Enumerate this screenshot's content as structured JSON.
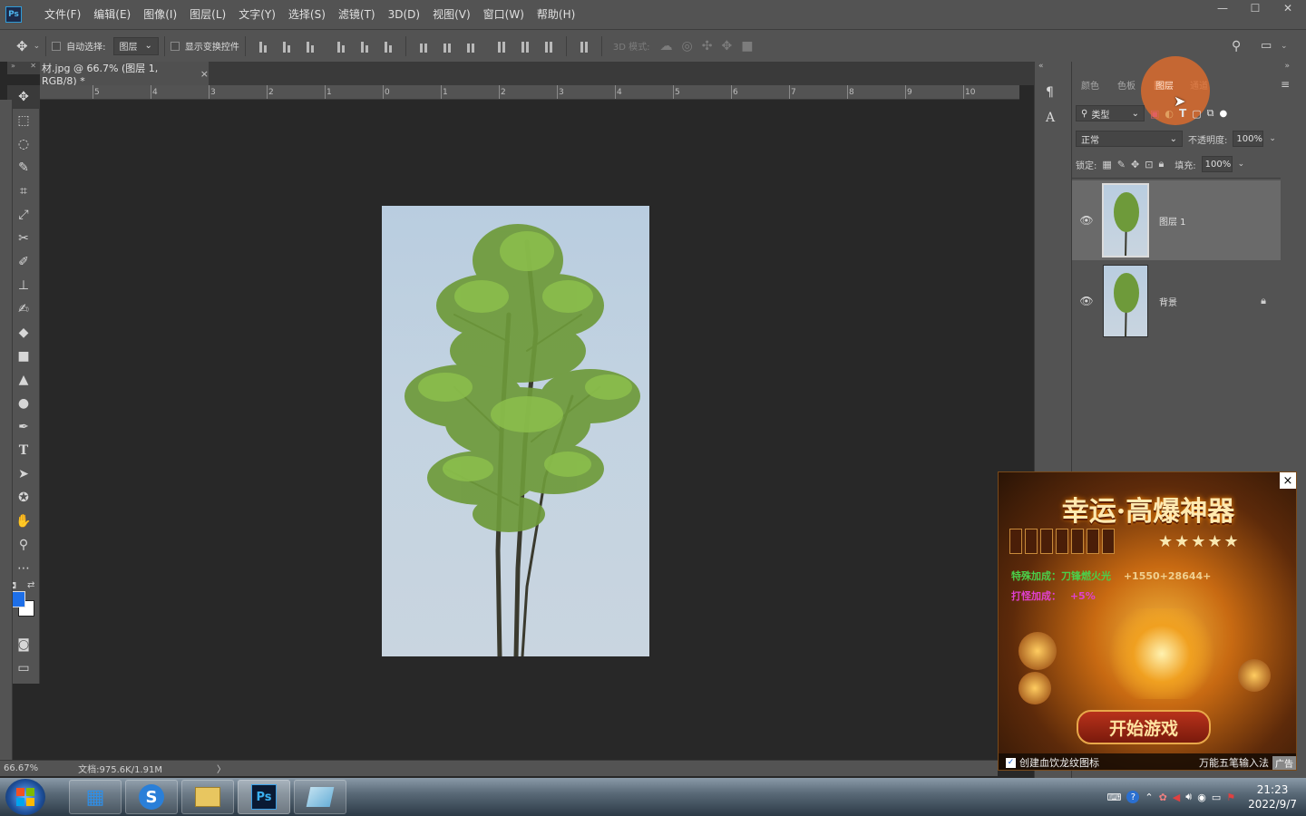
{
  "app": {
    "logo": "Ps"
  },
  "menu": [
    "文件(F)",
    "编辑(E)",
    "图像(I)",
    "图层(L)",
    "文字(Y)",
    "选择(S)",
    "滤镜(T)",
    "3D(D)",
    "视图(V)",
    "窗口(W)",
    "帮助(H)"
  ],
  "options": {
    "auto_select_label": "自动选择:",
    "auto_select_value": "图层",
    "show_transform_label": "显示变换控件",
    "mode_3d_label": "3D 模式:"
  },
  "document": {
    "tab_title": "材.jpg @ 66.7% (图层 1, RGB/8) *",
    "close": "×"
  },
  "ruler": {
    "ticks": [
      "5",
      "4",
      "3",
      "2",
      "1",
      "0",
      "1",
      "2",
      "3",
      "4",
      "5",
      "6",
      "7",
      "8",
      "9",
      "10"
    ]
  },
  "status": {
    "zoom": "66.67%",
    "doc_info": "文档:975.6K/1.91M",
    "arrow": "〉"
  },
  "panel": {
    "tabs": [
      "颜色",
      "色板",
      "图层",
      "通道"
    ],
    "active_tab": "图层",
    "filter_kind": "类型",
    "blend_mode": "正常",
    "opacity_label": "不透明度:",
    "opacity_value": "100%",
    "lock_label": "锁定:",
    "fill_label": "填充:",
    "fill_value": "100%",
    "layers": [
      {
        "name": "图层 1",
        "selected": true,
        "locked": false
      },
      {
        "name": "背景",
        "selected": false,
        "locked": true
      }
    ]
  },
  "ad": {
    "title": "幸运·高爆神器",
    "line1": "特殊加成：刀锋燃火光",
    "line1_value": "+1550+28644+",
    "line2": "打怪加成：",
    "line2_value": "+5%",
    "button": "开始游戏",
    "checkbox_label": "创建血饮龙纹图标",
    "ime_label": "万能五笔输入法",
    "ad_tag": "广告",
    "close": "×"
  },
  "taskbar": {
    "time": "21:23",
    "date": "2022/9/7",
    "apps": [
      "windows-explorer",
      "sogou",
      "file-manager",
      "photoshop",
      "notes"
    ]
  },
  "colors": {
    "accent_blue": "#1e6fe8",
    "panel_bg": "#535353",
    "canvas_bg": "#282828"
  }
}
